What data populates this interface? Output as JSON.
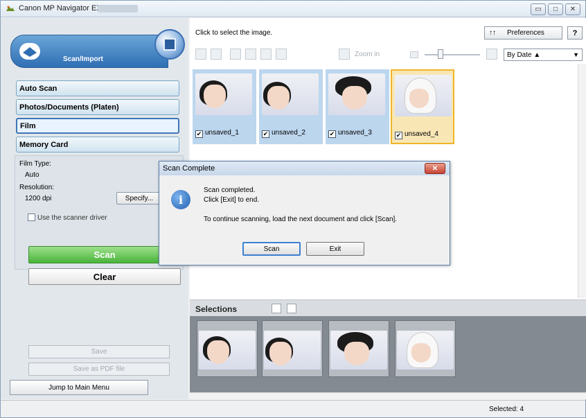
{
  "window": {
    "title": "Canon MP Navigator EX",
    "controls": {
      "minimize_icon": "minimize-icon",
      "maximize_icon": "maximize-icon",
      "close_icon": "close-icon"
    }
  },
  "left_panel": {
    "header_label": "Scan/Import",
    "modes": [
      "Auto Scan",
      "Photos/Documents (Platen)",
      "Film",
      "Memory Card"
    ],
    "selected_mode": "Film",
    "settings": {
      "film_type_label": "Film Type:",
      "film_type_value": "Auto",
      "resolution_label": "Resolution:",
      "resolution_value": "1200 dpi",
      "specify_button": "Specify...",
      "use_driver_label": "Use the scanner driver",
      "use_driver_checked": false
    },
    "scan_button": "Scan",
    "clear_button": "Clear",
    "save_button": "Save",
    "save_pdf_button": "Save as PDF file",
    "jump_button": "Jump to Main Menu"
  },
  "main": {
    "hint": "Click to select the image.",
    "preferences_button": "Preferences",
    "help_button": "?",
    "zoom_label": "Zoom in",
    "sort_select": "By Date ▲",
    "thumbnails": [
      {
        "label": "unsaved_1",
        "checked": true,
        "selected": false
      },
      {
        "label": "unsaved_2",
        "checked": true,
        "selected": false
      },
      {
        "label": "unsaved_3",
        "checked": true,
        "selected": false
      },
      {
        "label": "unsaved_4",
        "checked": true,
        "selected": true
      }
    ],
    "selections_title": "Selections"
  },
  "status": {
    "selected_text": "Selected: 4"
  },
  "dialog": {
    "title": "Scan Complete",
    "line1": "Scan completed.",
    "line2": "Click [Exit] to end.",
    "line3": "To continue scanning, load the next document and click [Scan].",
    "scan_button": "Scan",
    "exit_button": "Exit"
  }
}
